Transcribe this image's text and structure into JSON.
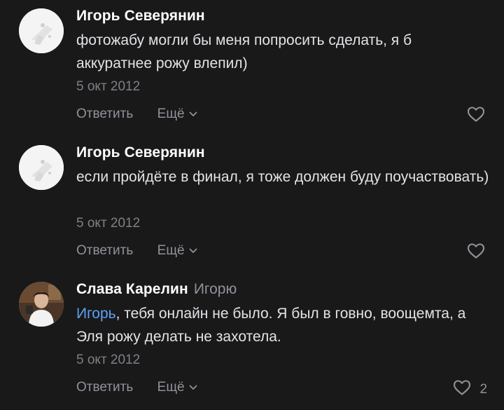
{
  "comments": [
    {
      "author": "Игорь Северянин",
      "reply_to": "",
      "mention": "",
      "text": "фотожабу могли бы меня попросить сделать, я б аккуратнее рожу влепил)",
      "date": "5 окт 2012",
      "reply_label": "Ответить",
      "more_label": "Ещё",
      "likes": ""
    },
    {
      "author": "Игорь Северянин",
      "reply_to": "",
      "mention": "",
      "text": "если пройдёте в финал, я тоже должен буду поучаствовать)",
      "date": "5 окт 2012",
      "reply_label": "Ответить",
      "more_label": "Ещё",
      "likes": ""
    },
    {
      "author": "Слава Карелин",
      "reply_to": "Игорю",
      "mention": "Игорь",
      "text": ", тебя онлайн не было. Я был в говно, воощемта, а Эля рожу делать не захотела.",
      "date": "5 окт 2012",
      "reply_label": "Ответить",
      "more_label": "Ещё",
      "likes": "2"
    }
  ],
  "colors": {
    "background": "#19191a",
    "author": "#ffffff",
    "text": "#e1e3e6",
    "secondary": "#8f9399",
    "mention": "#5aa3f2"
  },
  "icons": [
    "chevron-down-icon",
    "heart-icon"
  ]
}
